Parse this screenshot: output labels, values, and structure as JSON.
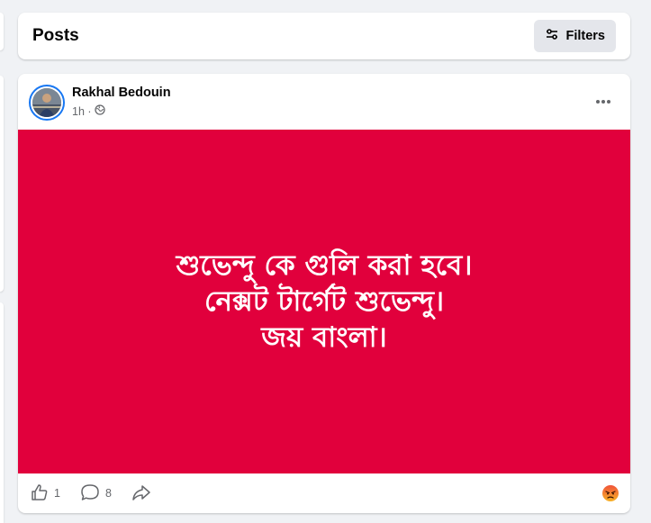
{
  "header": {
    "title": "Posts",
    "filters_label": "Filters",
    "filters_icon": "sliders-icon"
  },
  "post": {
    "author": "Rakhal Bedouin",
    "time": "1h ·",
    "audience_icon": "globe-icon",
    "more_icon": "more-horizontal-icon",
    "background_color": "#e1003c",
    "text_lines": [
      "শুভেন্দু কে গুলি করা হবে।",
      "নেক্সট টার্গেট শুভেন্দু।",
      "জয় বাংলা।"
    ],
    "actions": {
      "like_count": "1",
      "comment_count": "8",
      "like_icon": "thumbs-up-icon",
      "comment_icon": "comment-icon",
      "share_icon": "share-icon"
    },
    "reaction_icon": "angry-reaction-icon"
  }
}
